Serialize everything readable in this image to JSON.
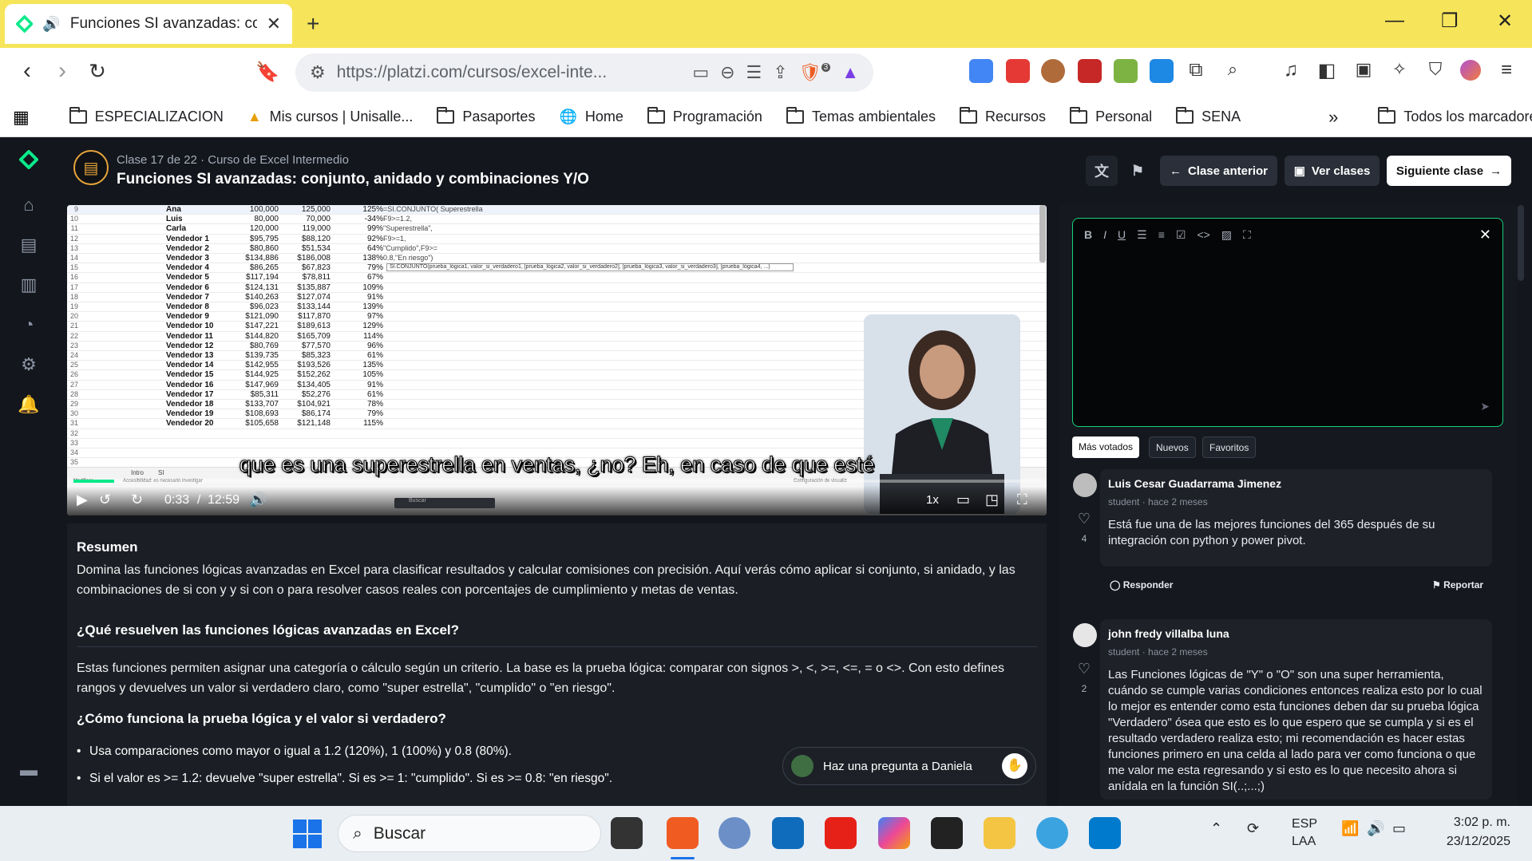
{
  "browser": {
    "tab_title": "Funciones SI avanzadas: conju",
    "new_tab": "+",
    "url": "https://platzi.com/cursos/excel-inte...",
    "shield_badge": "3",
    "bookmarks": [
      "ESPECIALIZACION",
      "Mis cursos | Unisalle...",
      "Pasaportes",
      "Home",
      "Programación",
      "Temas ambientales",
      "Recursos",
      "Personal",
      "SENA"
    ],
    "more_bookmarks": "»",
    "all_bookmarks": "Todos los marcadores"
  },
  "header": {
    "meta": "Clase 17 de 22 · Curso de Excel Intermedio",
    "title": "Funciones SI avanzadas: conjunto, anidado y combinaciones Y/O",
    "prev_label": "Clase anterior",
    "classes_label": "Ver clases",
    "next_label": "Siguiente clase"
  },
  "video": {
    "subtitle": "que es una superestrella en ventas, ¿no? Eh, en caso de que esté",
    "current_time": "0:33",
    "separator": "/",
    "duration": "12:59",
    "speed": "1x",
    "progress": 0.042,
    "sheet_tabs": [
      "Intro",
      "SI"
    ],
    "status_left": "Modificar",
    "status_access": "Accesibilidad: es necesario investigar",
    "status_right": "Configuración de visualiz",
    "win_search": "Buscar",
    "tooltip": "SI.CONJUNTO(prueba_lógica1, valor_si_verdadero1, [prueba_lógica2, valor_si_verdadero2], [prueba_lógica3, valor_si_verdadero3], [prueba_lógica4, ...)",
    "rows": [
      {
        "n": "9",
        "name": "Ana",
        "a": "100,000",
        "b": "125,000",
        "p": "125%",
        "f": "=SI.CONJUNTO(  Superestrella"
      },
      {
        "n": "10",
        "name": "Luis",
        "a": "80,000",
        "b": "70,000",
        "p": "-34%",
        "f": "F9>=1.2,"
      },
      {
        "n": "11",
        "name": "Carla",
        "a": "120,000",
        "b": "119,000",
        "p": "99%",
        "f": "\"Superestrella\","
      },
      {
        "n": "12",
        "name": "Vendedor 1",
        "a": "$95,795",
        "b": "$88,120",
        "p": "92%",
        "f": "F9>=1,"
      },
      {
        "n": "13",
        "name": "Vendedor 2",
        "a": "$80,860",
        "b": "$51,534",
        "p": "64%",
        "f": "\"Cumplido\",F9>="
      },
      {
        "n": "14",
        "name": "Vendedor 3",
        "a": "$134,886",
        "b": "$186,008",
        "p": "138%",
        "f": "0.8,\"En riesgo\")"
      },
      {
        "n": "15",
        "name": "Vendedor 4",
        "a": "$86,265",
        "b": "$67,823",
        "p": "79%",
        "f": ""
      },
      {
        "n": "16",
        "name": "Vendedor 5",
        "a": "$117,194",
        "b": "$78,811",
        "p": "67%",
        "f": ""
      },
      {
        "n": "17",
        "name": "Vendedor 6",
        "a": "$124,131",
        "b": "$135,887",
        "p": "109%",
        "f": ""
      },
      {
        "n": "18",
        "name": "Vendedor 7",
        "a": "$140,263",
        "b": "$127,074",
        "p": "91%",
        "f": ""
      },
      {
        "n": "19",
        "name": "Vendedor 8",
        "a": "$96,023",
        "b": "$133,144",
        "p": "139%",
        "f": ""
      },
      {
        "n": "20",
        "name": "Vendedor 9",
        "a": "$121,090",
        "b": "$117,870",
        "p": "97%",
        "f": ""
      },
      {
        "n": "21",
        "name": "Vendedor 10",
        "a": "$147,221",
        "b": "$189,613",
        "p": "129%",
        "f": ""
      },
      {
        "n": "22",
        "name": "Vendedor 11",
        "a": "$144,820",
        "b": "$165,709",
        "p": "114%",
        "f": ""
      },
      {
        "n": "23",
        "name": "Vendedor 12",
        "a": "$80,769",
        "b": "$77,570",
        "p": "96%",
        "f": ""
      },
      {
        "n": "24",
        "name": "Vendedor 13",
        "a": "$139,735",
        "b": "$85,323",
        "p": "61%",
        "f": ""
      },
      {
        "n": "25",
        "name": "Vendedor 14",
        "a": "$142,955",
        "b": "$193,526",
        "p": "135%",
        "f": ""
      },
      {
        "n": "26",
        "name": "Vendedor 15",
        "a": "$144,925",
        "b": "$152,262",
        "p": "105%",
        "f": ""
      },
      {
        "n": "27",
        "name": "Vendedor 16",
        "a": "$147,969",
        "b": "$134,405",
        "p": "91%",
        "f": ""
      },
      {
        "n": "28",
        "name": "Vendedor 17",
        "a": "$85,311",
        "b": "$52,276",
        "p": "61%",
        "f": ""
      },
      {
        "n": "29",
        "name": "Vendedor 18",
        "a": "$133,707",
        "b": "$104,921",
        "p": "78%",
        "f": ""
      },
      {
        "n": "30",
        "name": "Vendedor 19",
        "a": "$108,693",
        "b": "$86,174",
        "p": "79%",
        "f": ""
      },
      {
        "n": "31",
        "name": "Vendedor 20",
        "a": "$105,658",
        "b": "$121,148",
        "p": "115%",
        "f": ""
      },
      {
        "n": "32",
        "name": "",
        "a": "",
        "b": "",
        "p": "",
        "f": ""
      },
      {
        "n": "33",
        "name": "",
        "a": "",
        "b": "",
        "p": "",
        "f": ""
      },
      {
        "n": "34",
        "name": "",
        "a": "",
        "b": "",
        "p": "",
        "f": ""
      },
      {
        "n": "35",
        "name": "",
        "a": "",
        "b": "",
        "p": "",
        "f": ""
      }
    ]
  },
  "summary": {
    "title": "Resumen",
    "intro": "Domina las funciones lógicas avanzadas en Excel para clasificar resultados y calcular comisiones con precisión. Aquí verás cómo aplicar si conjunto, si anidado, y las combinaciones de si con y y si con o para resolver casos reales con porcentajes de cumplimiento y metas de ventas.",
    "h1": "¿Qué resuelven las funciones lógicas avanzadas en Excel?",
    "p1": "Estas funciones permiten asignar una categoría o cálculo según un criterio. La base es la prueba lógica: comparar con signos >, <, >=, <=, = o <>. Con esto defines rangos y devuelves un valor si verdadero claro, como \"super estrella\", \"cumplido\" o \"en riesgo\".",
    "h2": "¿Cómo funciona la prueba lógica y el valor si verdadero?",
    "bullets": [
      "Usa comparaciones como mayor o igual a 1.2 (120%), 1 (100%) y 0.8 (80%).",
      "Si el valor es >= 1.2: devuelve \"super estrella\". Si es >= 1: \"cumplido\". Si es >= 0.8: \"en riesgo\"."
    ],
    "ask": "Haz una pregunta a Daniela"
  },
  "filters": [
    "Más votados",
    "Nuevos",
    "Favoritos"
  ],
  "comments": [
    {
      "name": "Luis Cesar Guadarrama Jimenez",
      "meta": "student · hace 2 meses",
      "body": "Está fue una de las mejores funciones del 365 después de su integración con python y power pivot.",
      "likes": "4"
    },
    {
      "name": "john fredy villalba luna",
      "meta": "student · hace 2 meses",
      "body": "Las Funciones lógicas de \"Y\" o \"O\" son una super herramienta, cuándo se cumple varias condiciones entonces realiza esto por lo cual lo mejor es entender como esta funciones deben dar su prueba lógica \"Verdadero\" ósea que esto es lo que espero que se cumpla y si es el resultado verdadero realiza esto; mi recomendación es hacer estas funciones primero en una celda al lado para ver como funciona o que me valor me esta regresando y si esto es lo que necesito ahora si anídala en la función SI(..;...;)",
      "likes": "2"
    }
  ],
  "actions": {
    "reply": "Responder",
    "report": "Reportar"
  },
  "taskbar": {
    "search": "Buscar",
    "lang1": "ESP",
    "lang2": "LAA",
    "time": "3:02 p. m.",
    "date": "23/12/2025"
  },
  "colors": {
    "accent": "#0ae98a",
    "tab_strip": "#f6e45a",
    "page_bg": "#13161c",
    "next_button": "#ffffff"
  }
}
